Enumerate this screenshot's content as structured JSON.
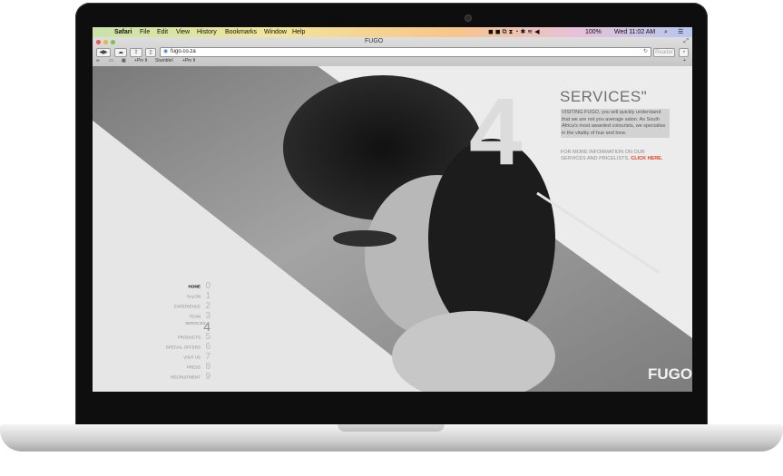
{
  "menubar": {
    "app": "Safari",
    "items": [
      "File",
      "Edit",
      "View",
      "History",
      "Bookmarks",
      "Window",
      "Help"
    ],
    "battery": "100%",
    "clock": "Wed 11:02 AM"
  },
  "browser": {
    "window_title": "FUGO",
    "url": "fugo.co.za",
    "reader_label": "Reader",
    "bookmarks": [
      "+Pin It",
      "StumbleI",
      "+Pin It"
    ]
  },
  "site": {
    "logo": "FUGO",
    "big_number": "4",
    "section_title": "SERVICES\"",
    "section_text": "VISITING FUGO, you will quickly understand that we are not you average salon. As South Africa's most awarded colourists, we specialise in the vitality of hue and tone.",
    "more_info": "FOR MORE INFORMATION ON OUR SERVICES AND PRICELISTS,",
    "cta": "CLICK HERE.",
    "nav": [
      {
        "label": "HOME",
        "num": "0"
      },
      {
        "label": "SALON",
        "num": "1"
      },
      {
        "label": "EXPERIENCE",
        "num": "2"
      },
      {
        "label": "TEAM",
        "num": "3"
      },
      {
        "label": "",
        "num": "4",
        "extra": "SERVICES"
      },
      {
        "label": "PRODUCTS",
        "num": "5"
      },
      {
        "label": "SPECIAL OFFERS",
        "num": "6"
      },
      {
        "label": "VISIT US",
        "num": "7"
      },
      {
        "label": "PRESS",
        "num": "8"
      },
      {
        "label": "RECRUITMENT",
        "num": "9"
      }
    ]
  }
}
